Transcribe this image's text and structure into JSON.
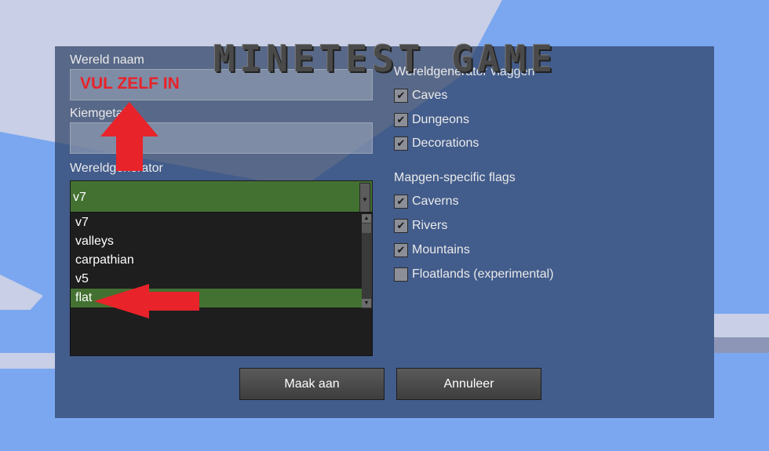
{
  "title": "MINETEST GAME",
  "left": {
    "world_name_label": "Wereld naam",
    "world_name_value": "VUL ZELF IN",
    "seed_label": "Kiemgetal",
    "seed_value": "",
    "mapgen_label": "Wereldgenerator",
    "mapgen_selected": "v7",
    "mapgen_options": [
      "v7",
      "valleys",
      "carpathian",
      "v5",
      "flat"
    ],
    "mapgen_highlighted": "flat"
  },
  "right": {
    "flags_heading": "Wereldgenerator vlaggen",
    "flags": [
      {
        "label": "Caves",
        "checked": true
      },
      {
        "label": "Dungeons",
        "checked": true
      },
      {
        "label": "Decorations",
        "checked": true
      }
    ],
    "specific_heading": "Mapgen-specific flags",
    "specific_flags": [
      {
        "label": "Caverns",
        "checked": true
      },
      {
        "label": "Rivers",
        "checked": true
      },
      {
        "label": "Mountains",
        "checked": true
      },
      {
        "label": "Floatlands (experimental)",
        "checked": false
      }
    ]
  },
  "buttons": {
    "create": "Maak aan",
    "cancel": "Annuleer"
  },
  "colors": {
    "selection_green": "#437131",
    "annotation_red": "#e8232a"
  },
  "icons": {
    "check": "✔",
    "scroll_up": "▲",
    "scroll_down": "▼",
    "dropdown": "▼"
  }
}
